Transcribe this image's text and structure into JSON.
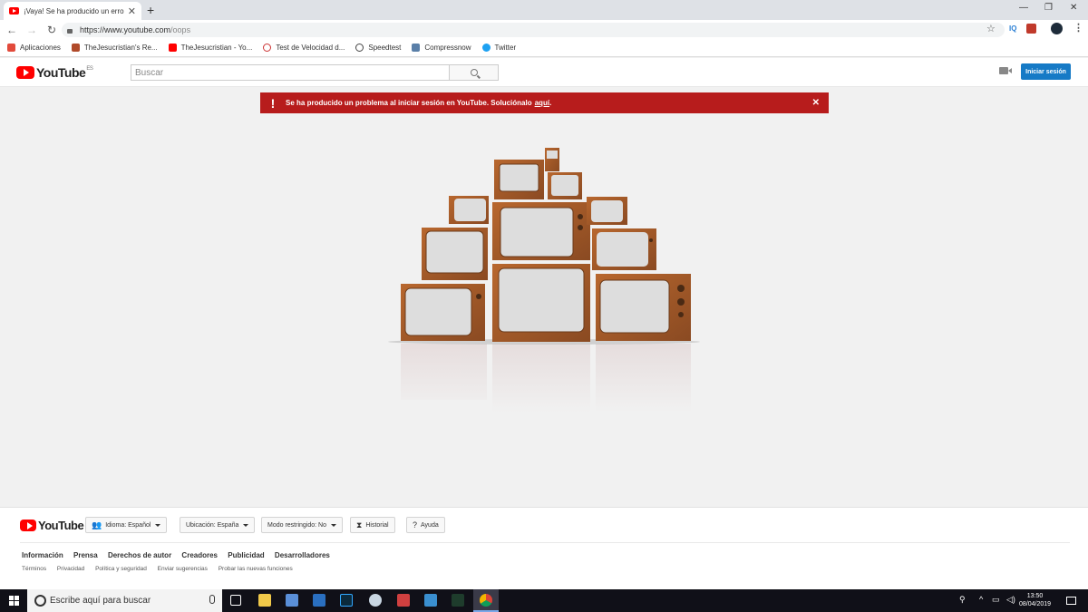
{
  "browser": {
    "tab_title": "¡Vaya! Se ha producido un error",
    "url_main": "https://www.youtube.com",
    "url_path": "/oops",
    "extensions": [
      "IQ"
    ],
    "bookmarks": [
      {
        "label": "Aplicaciones",
        "icon": "apps-grid-icon",
        "color": "#e24a3b"
      },
      {
        "label": "TheJesucristian's Re...",
        "icon": "bookmark-icon",
        "color": "#b04a2a"
      },
      {
        "label": "TheJesucristian - Yo...",
        "icon": "youtube-icon",
        "color": "#ff0000"
      },
      {
        "label": "Test de Velocidad d...",
        "icon": "speed-icon",
        "color": "#cc3333"
      },
      {
        "label": "Speedtest",
        "icon": "gauge-icon",
        "color": "#444444"
      },
      {
        "label": "Compressnow",
        "icon": "compress-icon",
        "color": "#5a7fa8"
      },
      {
        "label": "Twitter",
        "icon": "twitter-icon",
        "color": "#1da1f2"
      }
    ]
  },
  "header": {
    "logo_text": "YouTube",
    "logo_region": "ES",
    "search_placeholder": "Buscar",
    "signin_label": "Iniciar sesión"
  },
  "alert": {
    "message": "Se ha producido un problema al iniciar sesión en YouTube. Soluciónalo",
    "link_text": "aquí",
    "period": "."
  },
  "footer": {
    "logo_text": "YouTube",
    "language_label": "Idioma: Español",
    "location_label": "Ubicación: España",
    "restricted_label": "Modo restringido: No",
    "history_label": "Historial",
    "help_label": "Ayuda",
    "links": [
      "Información",
      "Prensa",
      "Derechos de autor",
      "Creadores",
      "Publicidad",
      "Desarrolladores"
    ],
    "sublinks": [
      "Términos",
      "Privacidad",
      "Política y seguridad",
      "Enviar sugerencias",
      "Probar las nuevas funciones"
    ]
  },
  "taskbar": {
    "search_placeholder": "Escribe aquí para buscar",
    "time": "13:50",
    "date": "08/04/2019"
  },
  "colors": {
    "youtube_red": "#ff0000",
    "alert_red": "#b71c1c",
    "signin_blue": "#167ac6",
    "tv_wood": "#a0582a"
  }
}
